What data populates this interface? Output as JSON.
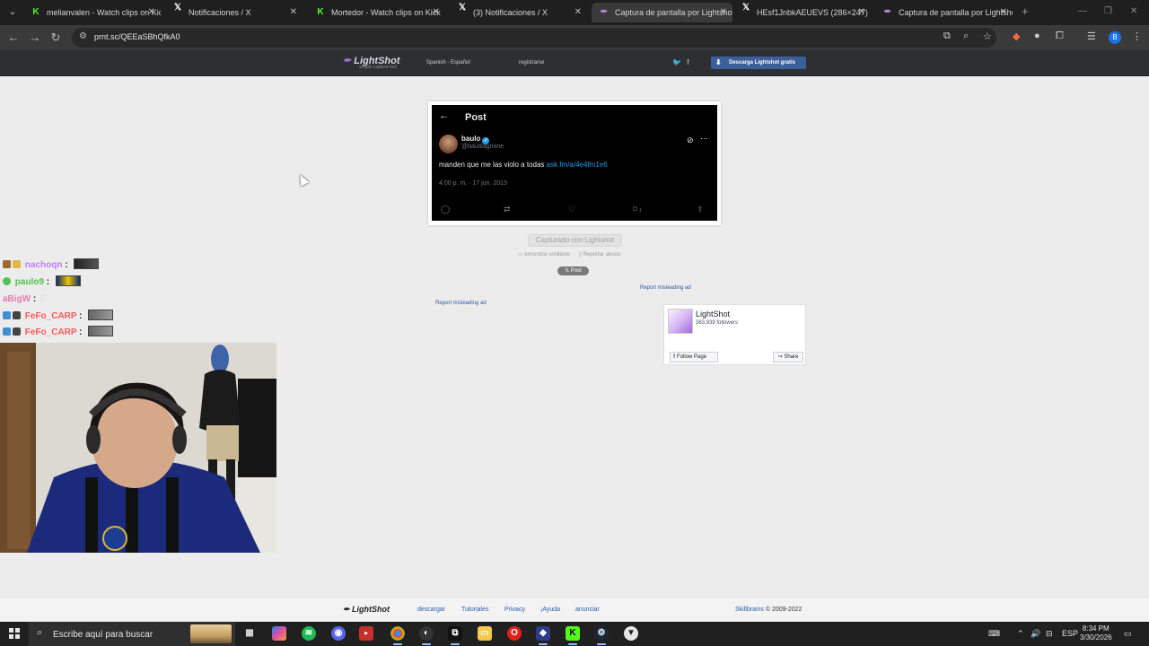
{
  "browser": {
    "tabs": [
      {
        "title": "melianvalen - Watch clips on Kick",
        "icon": "kick-icon"
      },
      {
        "title": "Notificaciones / X",
        "icon": "x-icon"
      },
      {
        "title": "Mortedor - Watch clips on Kick",
        "icon": "kick-icon"
      },
      {
        "title": "(3) Notificaciones / X",
        "icon": "x-icon"
      },
      {
        "title": "Captura de pantalla por Lightshot",
        "icon": "lightshot-icon",
        "active": true
      },
      {
        "title": "HEsf1JnbkAEUEVS (286×247)",
        "icon": "x-icon"
      },
      {
        "title": "Captura de pantalla por Lightshot",
        "icon": "lightshot-icon"
      }
    ],
    "url": "prnt.sc/QEEaSBhQfkA0"
  },
  "lightshot": {
    "logo": "LightShot",
    "tagline": "simple capture tool",
    "language": "Spanish - Español",
    "register": "registrarse",
    "download_button": "Descarga Lightshot gratis",
    "captured_label": "Capturado con Lightshot",
    "find_similar": "encontrar similares",
    "report_abuse": "Reportar abuso",
    "x_post_button": "Post",
    "report_ad_1": "Report misleading ad",
    "report_ad_2": "Report misleading ad"
  },
  "tweet": {
    "header_title": "Post",
    "name": "baulo",
    "handle": "@bautilagnone",
    "text": "manden que me las violo a todas",
    "link": "ask.fm/a/4e4fm1e6",
    "timestamp": "4:00 p. m. · 17 jun. 2013",
    "bookmark_count": "1"
  },
  "facebook_widget": {
    "page_name": "LightShot",
    "followers": "383,939 followers",
    "follow_label": "Follow Page",
    "share_label": "Share"
  },
  "stream_chat": [
    {
      "user": "nachoqn",
      "color": "#c07cff"
    },
    {
      "user": "paulo9",
      "color": "#4ec24e"
    },
    {
      "user": "aBigW",
      "color": "#e07fb0"
    },
    {
      "user": "FeFo_CARP",
      "color": "#ff5a5a"
    },
    {
      "user": "FeFo_CARP",
      "color": "#ff5a5a"
    }
  ],
  "footer": {
    "logo": "LightShot",
    "links": [
      "descargar",
      "Tutoriales",
      "Privacy",
      "¡Ayuda",
      "anunciar"
    ],
    "skillbrains": "Skillbrains",
    "copyright": "© 2009-2022"
  },
  "taskbar": {
    "search_placeholder": "Escribe aquí para buscar",
    "language": "ESP",
    "time": "8:34 PM",
    "date": "3/30/2026"
  }
}
